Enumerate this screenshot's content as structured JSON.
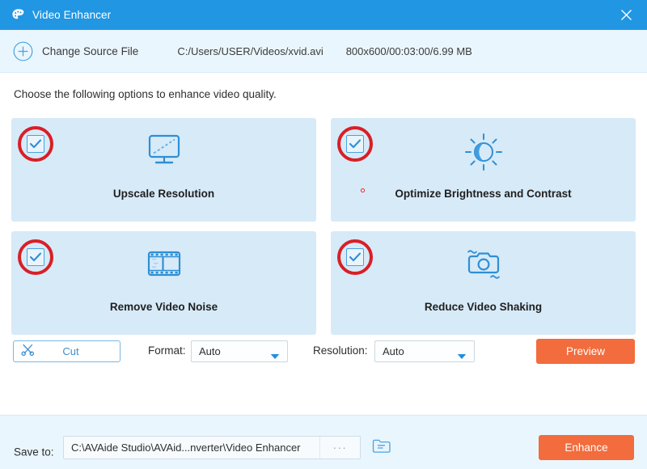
{
  "window": {
    "title": "Video Enhancer",
    "logo_icon": "palette-icon",
    "close_icon": "close-icon",
    "titlebar_color": "#2196e3"
  },
  "source_bar": {
    "plus_icon": "plus-circle-icon",
    "change_source_label": "Change Source File",
    "file_path": "C:/Users/USER/Videos/xvid.avi",
    "file_meta": "800x600/00:03:00/6.99 MB"
  },
  "main": {
    "instruction": "Choose the following options to enhance video quality.",
    "options": [
      {
        "label": "Upscale Resolution",
        "icon": "monitor-icon",
        "checked": true,
        "highlighted": true
      },
      {
        "label": "Optimize Brightness and Contrast",
        "icon": "brightness-sun-icon",
        "checked": true,
        "highlighted": true
      },
      {
        "label": "Remove Video Noise",
        "icon": "film-strip-icon",
        "checked": true,
        "highlighted": true
      },
      {
        "label": "Reduce Video Shaking",
        "icon": "camera-shake-icon",
        "checked": true,
        "highlighted": true
      }
    ]
  },
  "controls": {
    "cut_label": "Cut",
    "cut_icon": "scissors-icon",
    "format_label": "Format:",
    "format_value": "Auto",
    "resolution_label": "Resolution:",
    "resolution_value": "Auto",
    "dropdown_icon": "chevron-down-icon",
    "preview_label": "Preview"
  },
  "footer": {
    "save_to_label": "Save to:",
    "save_path": "C:\\AVAide Studio\\AVAid...nverter\\Video Enhancer",
    "browse_label": "···",
    "folder_icon": "folder-open-icon",
    "enhance_label": "Enhance"
  },
  "colors": {
    "accent_blue": "#2196e3",
    "card_blue": "#d7eaf8",
    "action_orange": "#f26c3d",
    "annotation_red": "#d81f26"
  }
}
